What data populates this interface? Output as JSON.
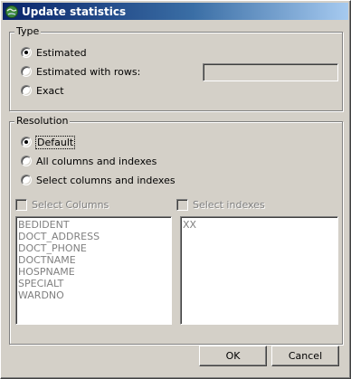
{
  "window": {
    "title": "Update statistics",
    "icon": "globe-app-icon"
  },
  "type_group": {
    "legend": "Type",
    "options": [
      {
        "label": "Estimated",
        "checked": true
      },
      {
        "label": "Estimated with rows:",
        "checked": false
      },
      {
        "label": "Exact",
        "checked": false
      }
    ],
    "rows_value": ""
  },
  "resolution_group": {
    "legend": "Resolution",
    "options": [
      {
        "label": "Default",
        "checked": true
      },
      {
        "label": "All columns and indexes",
        "checked": false
      },
      {
        "label": "Select columns and indexes",
        "checked": false
      }
    ],
    "select_columns_label": "Select Columns",
    "select_indexes_label": "Select indexes",
    "columns": [
      "BEDIDENT",
      "DOCT_ADDRESS",
      "DOCT_PHONE",
      "DOCTNAME",
      "HOSPNAME",
      "SPECIALT",
      "WARDNO"
    ],
    "indexes": [
      "XX"
    ]
  },
  "buttons": {
    "ok": "OK",
    "cancel": "Cancel"
  }
}
